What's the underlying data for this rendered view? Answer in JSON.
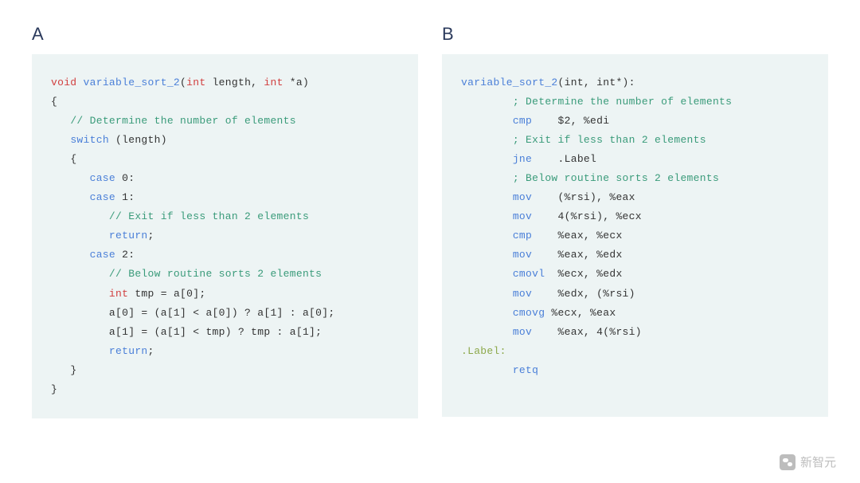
{
  "panel_a": {
    "label": "A",
    "code": {
      "sig_void": "void",
      "sig_func": "variable_sort_2",
      "sig_open": "(",
      "sig_int1": "int",
      "sig_len": " length, ",
      "sig_int2": "int",
      "sig_ptr": " *a)",
      "brace_open": "{",
      "comment_determine": "// Determine the number of elements",
      "switch_kw": "switch",
      "switch_expr": " (length)",
      "brace_open2": "{",
      "case0": "case",
      "case0_val": " 0:",
      "case1": "case",
      "case1_val": " 1:",
      "comment_exit": "// Exit if less than 2 elements",
      "return1": "return",
      "return1_semi": ";",
      "case2": "case",
      "case2_val": " 2:",
      "comment_sort": "// Below routine sorts 2 elements",
      "int_tmp": "int",
      "tmp_assign": " tmp = a[0];",
      "a0_assign": "a[0] = (a[1] < a[0]) ? a[1] : a[0];",
      "a1_assign": "a[1] = (a[1] < tmp) ? tmp : a[1];",
      "return2": "return",
      "return2_semi": ";",
      "brace_close2": "}",
      "brace_close": "}"
    }
  },
  "panel_b": {
    "label": "B",
    "code": {
      "sig_func": "variable_sort_2",
      "sig_args": "(int, int*):",
      "comment_determine": "; Determine the number of elements",
      "cmp1": "cmp",
      "cmp1_args": "    $2, %edi",
      "comment_exit": "; Exit if less than 2 elements",
      "jne": "jne",
      "jne_arg": "    .Label",
      "comment_sort": "; Below routine sorts 2 elements",
      "mov1": "mov",
      "mov1_args": "    (%rsi), %eax",
      "mov2": "mov",
      "mov2_args": "    4(%rsi), %ecx",
      "cmp2": "cmp",
      "cmp2_args": "    %eax, %ecx",
      "mov3": "mov",
      "mov3_args": "    %eax, %edx",
      "cmovl": "cmovl",
      "cmovl_args": "  %ecx, %edx",
      "mov4": "mov",
      "mov4_args": "    %edx, (%rsi)",
      "cmovg": "cmovg",
      "cmovg_args": " %ecx, %eax",
      "mov5": "mov",
      "mov5_args": "    %eax, 4(%rsi)",
      "label": ".Label:",
      "retq": "retq"
    }
  },
  "watermark": {
    "text": "新智元"
  }
}
